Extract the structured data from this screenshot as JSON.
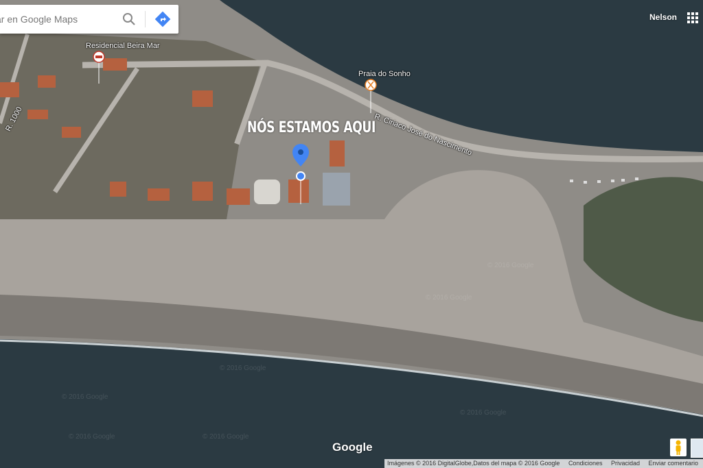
{
  "search": {
    "placeholder": "ar en Google Maps"
  },
  "account": {
    "user_name": "Nelson"
  },
  "places": [
    {
      "id": "residencial",
      "label": "Residencial Beira Mar"
    },
    {
      "id": "praia",
      "label": "Praia do Sonho"
    }
  ],
  "streets": [
    {
      "id": "ciriaco",
      "label": "R. Ciriaco José do Nascimento"
    },
    {
      "id": "r1000",
      "label": "R. 1000"
    }
  ],
  "headline": "NÓS ESTAMOS AQUI",
  "logo": "Google",
  "footer": {
    "attribution": "Imágenes © 2016 DigitalGlobe,Datos del mapa © 2016 Google",
    "conditions": "Condiciones",
    "privacy": "Privacidad",
    "feedback": "Enviar comentario"
  },
  "colors": {
    "pin": "#4285f4",
    "ocean": "#2b3a42",
    "sand": "#a8a39d"
  },
  "icons": {
    "search": "search-icon",
    "directions": "directions-icon",
    "apps": "apps-grid-icon",
    "pegman": "pegman-icon"
  }
}
